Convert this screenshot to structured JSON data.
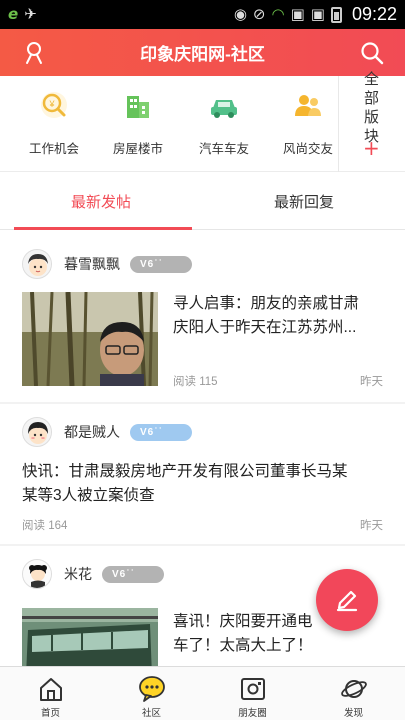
{
  "status_bar": {
    "time": "09:22",
    "left_icons": [
      "e-browser-icon",
      "toolkit-icon"
    ],
    "right_icons": [
      "eye-icon",
      "no-signal-icon",
      "wifi-icon",
      "sim-icon",
      "sim-icon",
      "battery-icon"
    ]
  },
  "header": {
    "title": "印象庆阳网-社区",
    "left_icon": "user-icon",
    "right_icon": "search-icon",
    "color": "#f24b55"
  },
  "categories": [
    {
      "label": "工作机会",
      "icon": "job-icon",
      "color": "#f0b93a"
    },
    {
      "label": "房屋楼市",
      "icon": "building-icon",
      "color": "#65c35a"
    },
    {
      "label": "汽车车友",
      "icon": "car-icon",
      "color": "#52c08a"
    },
    {
      "label": "风尚交友",
      "icon": "people-icon",
      "color": "#f5b52e"
    }
  ],
  "all_sections": {
    "label": "全部版块",
    "plus": "+"
  },
  "tabs": [
    {
      "label": "最新发帖",
      "active": true
    },
    {
      "label": "最新回复",
      "active": false
    }
  ],
  "posts": [
    {
      "user": "暮雪飘飘",
      "level": "V6",
      "level_color": "#b3b3b3",
      "title": "寻人启事：朋友的亲戚甘肃庆阳人于昨天在江苏苏州...",
      "title_line1": "寻人启事：朋友的亲戚甘肃",
      "title_line2": "庆阳人于昨天在江苏苏州...",
      "reads": "阅读 115",
      "time": "昨天",
      "has_image": true
    },
    {
      "user": "都是贼人",
      "level": "V6",
      "level_color": "#9fc9f0",
      "title_line1": "快讯：甘肃晟毅房地产开发有限公司董事长马某",
      "title_line2": "某等3人被立案侦查",
      "reads": "阅读 164",
      "time": "昨天",
      "has_image": false
    },
    {
      "user": "米花",
      "level": "V6",
      "level_color": "#b3b3b3",
      "title_line1": "喜讯！庆阳要开通电",
      "title_line2": "车了！太高大上了！",
      "has_image": true
    }
  ],
  "fab": {
    "icon": "pencil-icon",
    "color": "#f2475a"
  },
  "bottom_nav": [
    {
      "label": "首页",
      "icon": "home-icon"
    },
    {
      "label": "社区",
      "icon": "chat-bubble-icon"
    },
    {
      "label": "朋友圈",
      "icon": "moments-icon"
    },
    {
      "label": "发现",
      "icon": "planet-icon"
    }
  ]
}
